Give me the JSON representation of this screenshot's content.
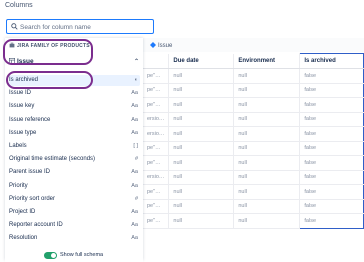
{
  "header": {
    "title": "Columns"
  },
  "search": {
    "placeholder": "Search for column name",
    "value": ""
  },
  "panel": {
    "family_label": "JIRA FAMILY OF PRODUCTS",
    "group_label": "Issue",
    "fields": [
      {
        "label": "Is archived",
        "type_icon": "toggle-icon",
        "glyph": "◐",
        "selected": true
      },
      {
        "label": "Issue ID",
        "type_icon": "text-icon",
        "glyph": "Aa"
      },
      {
        "label": "Issue key",
        "type_icon": "text-icon",
        "glyph": "Aa"
      },
      {
        "label": "Issue reference",
        "type_icon": "text-icon",
        "glyph": "Aa"
      },
      {
        "label": "Issue type",
        "type_icon": "text-icon",
        "glyph": "Aa"
      },
      {
        "label": "Labels",
        "type_icon": "list-icon",
        "glyph": "[ ]"
      },
      {
        "label": "Original time estimate (seconds)",
        "type_icon": "number-icon",
        "glyph": "#"
      },
      {
        "label": "Parent issue ID",
        "type_icon": "text-icon",
        "glyph": "Aa"
      },
      {
        "label": "Priority",
        "type_icon": "text-icon",
        "glyph": "Aa"
      },
      {
        "label": "Priority sort order",
        "type_icon": "number-icon",
        "glyph": "#"
      },
      {
        "label": "Project ID",
        "type_icon": "text-icon",
        "glyph": "Aa"
      },
      {
        "label": "Reporter account ID",
        "type_icon": "text-icon",
        "glyph": "Aa"
      },
      {
        "label": "Resolution",
        "type_icon": "text-icon",
        "glyph": "Aa"
      }
    ],
    "footer_label": "Show full schema"
  },
  "table": {
    "group_label": "Issue",
    "columns": [
      "",
      "Due date",
      "Environment",
      "Is archived"
    ],
    "rows": [
      [
        "pe\"…",
        "null",
        "null",
        "false"
      ],
      [
        "pe\"…",
        "null",
        "null",
        "false"
      ],
      [
        "pe\"…",
        "null",
        "null",
        "false"
      ],
      [
        "ersio…",
        "null",
        "null",
        "false"
      ],
      [
        "ersio…",
        "null",
        "null",
        "false"
      ],
      [
        "pe\"…",
        "null",
        "null",
        "false"
      ],
      [
        "pe\"…",
        "null",
        "null",
        "false"
      ],
      [
        "ersio…",
        "null",
        "null",
        "false"
      ],
      [
        "pe\"…",
        "null",
        "null",
        "false"
      ],
      [
        "pe\"…",
        "null",
        "null",
        "false"
      ],
      [
        "pe\"…",
        "null",
        "null",
        "false"
      ]
    ]
  },
  "colors": {
    "accent": "#1d7afc",
    "highlight_ring": "#7b2d8e",
    "toggle_on": "#22a06b",
    "selected_bg": "#e9f2ff"
  }
}
